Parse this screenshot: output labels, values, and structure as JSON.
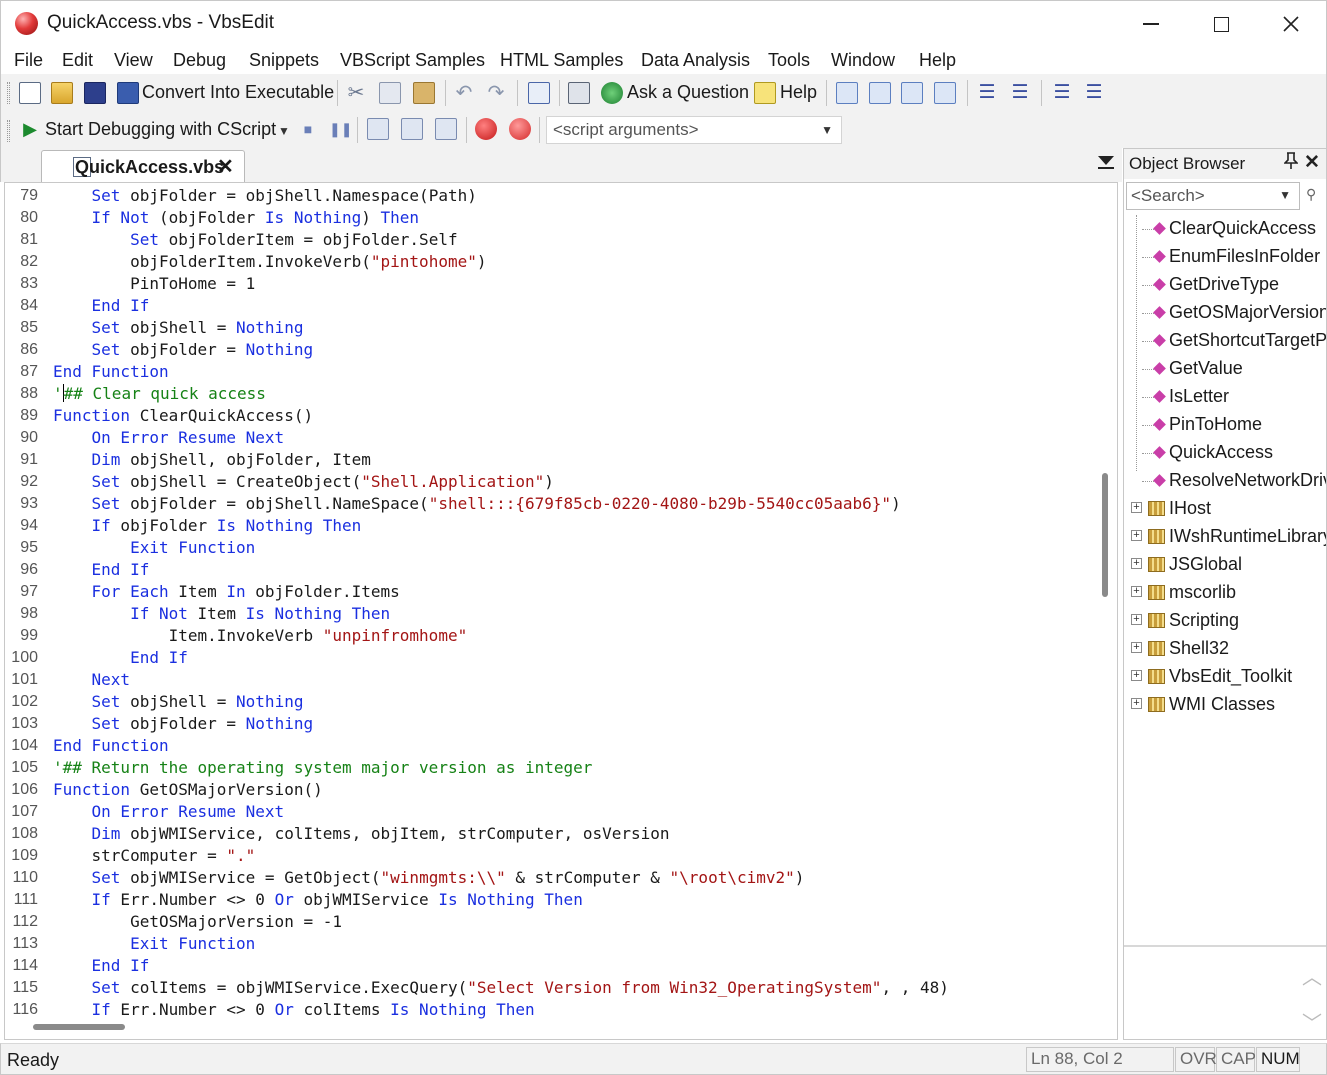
{
  "window": {
    "title": "QuickAccess.vbs - VbsEdit",
    "minimize_label": "—",
    "maximize_label": "☐",
    "close_label": "✕"
  },
  "menu": [
    "File",
    "Edit",
    "View",
    "Debug",
    "Snippets",
    "VBScript Samples",
    "HTML Samples",
    "Data Analysis",
    "Tools",
    "Window",
    "Help"
  ],
  "toolbar1": {
    "convert_label": "Convert Into Executable",
    "ask_label": "Ask a Question",
    "help_label": "Help",
    "icons": [
      "new-file-icon",
      "open-folder-icon",
      "save-icon",
      "convert-icon",
      "cut-icon",
      "copy-icon",
      "paste-icon",
      "undo-icon",
      "redo-icon",
      "browser-icon",
      "print-icon",
      "ask-icon",
      "help-icon",
      "bookmark-icons",
      "indent-icons"
    ]
  },
  "toolbar2": {
    "debug_label": "Start Debugging with CScript",
    "args_placeholder": "<script arguments>",
    "icons": [
      "play-icon",
      "stop-icon",
      "pause-icon",
      "step-icons",
      "breakpoint-icon",
      "clear-breakpoints-icon"
    ]
  },
  "editor": {
    "tab_label": "QuickAccess.vbs",
    "tab_close": "✕",
    "caret_line": 88,
    "lines": [
      {
        "n": "79",
        "segs": [
          [
            "",
            "    "
          ],
          [
            "kw",
            "Set"
          ],
          [
            "",
            " objFolder = objShell.Namespace(Path)"
          ]
        ]
      },
      {
        "n": "80",
        "segs": [
          [
            "",
            "    "
          ],
          [
            "kw",
            "If Not"
          ],
          [
            "",
            " (objFolder "
          ],
          [
            "kw",
            "Is Nothing"
          ],
          [
            "",
            ") "
          ],
          [
            "kw",
            "Then"
          ]
        ]
      },
      {
        "n": "81",
        "segs": [
          [
            "",
            "        "
          ],
          [
            "kw",
            "Set"
          ],
          [
            "",
            " objFolderItem = objFolder.Self"
          ]
        ]
      },
      {
        "n": "82",
        "segs": [
          [
            "",
            "        objFolderItem.InvokeVerb("
          ],
          [
            "str",
            "\"pintohome\""
          ],
          [
            "",
            ")"
          ]
        ]
      },
      {
        "n": "83",
        "segs": [
          [
            "",
            "        PinToHome = 1"
          ]
        ]
      },
      {
        "n": "84",
        "segs": [
          [
            "",
            "    "
          ],
          [
            "kw",
            "End If"
          ]
        ]
      },
      {
        "n": "85",
        "segs": [
          [
            "",
            "    "
          ],
          [
            "kw",
            "Set"
          ],
          [
            "",
            " objShell = "
          ],
          [
            "kw",
            "Nothing"
          ]
        ]
      },
      {
        "n": "86",
        "segs": [
          [
            "",
            "    "
          ],
          [
            "kw",
            "Set"
          ],
          [
            "",
            " objFolder = "
          ],
          [
            "kw",
            "Nothing"
          ]
        ]
      },
      {
        "n": "87",
        "segs": [
          [
            "kw",
            "End Function"
          ]
        ]
      },
      {
        "n": "88",
        "segs": [
          [
            "cmt",
            "'"
          ],
          [
            "caret",
            ""
          ],
          [
            "cmt",
            "## Clear quick access"
          ]
        ]
      },
      {
        "n": "89",
        "segs": [
          [
            "kw",
            "Function"
          ],
          [
            "",
            " ClearQuickAccess()"
          ]
        ]
      },
      {
        "n": "90",
        "segs": [
          [
            "",
            "    "
          ],
          [
            "kw",
            "On Error Resume Next"
          ]
        ]
      },
      {
        "n": "91",
        "segs": [
          [
            "",
            "    "
          ],
          [
            "kw",
            "Dim"
          ],
          [
            "",
            " objShell, objFolder, Item"
          ]
        ]
      },
      {
        "n": "92",
        "segs": [
          [
            "",
            "    "
          ],
          [
            "kw",
            "Set"
          ],
          [
            "",
            " objShell = CreateObject("
          ],
          [
            "str",
            "\"Shell.Application\""
          ],
          [
            "",
            ")"
          ]
        ]
      },
      {
        "n": "93",
        "segs": [
          [
            "",
            "    "
          ],
          [
            "kw",
            "Set"
          ],
          [
            "",
            " objFolder = objShell.NameSpace("
          ],
          [
            "str",
            "\"shell:::{679f85cb-0220-4080-b29b-5540cc05aab6}\""
          ],
          [
            "",
            ")"
          ]
        ]
      },
      {
        "n": "94",
        "segs": [
          [
            "",
            "    "
          ],
          [
            "kw",
            "If"
          ],
          [
            "",
            " objFolder "
          ],
          [
            "kw",
            "Is Nothing Then"
          ]
        ]
      },
      {
        "n": "95",
        "segs": [
          [
            "",
            "        "
          ],
          [
            "kw",
            "Exit Function"
          ]
        ]
      },
      {
        "n": "96",
        "segs": [
          [
            "",
            "    "
          ],
          [
            "kw",
            "End If"
          ]
        ]
      },
      {
        "n": "97",
        "segs": [
          [
            "",
            "    "
          ],
          [
            "kw",
            "For Each"
          ],
          [
            "",
            " Item "
          ],
          [
            "kw",
            "In"
          ],
          [
            "",
            " objFolder.Items"
          ]
        ]
      },
      {
        "n": "98",
        "segs": [
          [
            "",
            "        "
          ],
          [
            "kw",
            "If Not"
          ],
          [
            "",
            " Item "
          ],
          [
            "kw",
            "Is Nothing Then"
          ]
        ]
      },
      {
        "n": "99",
        "segs": [
          [
            "",
            "            Item.InvokeVerb "
          ],
          [
            "str",
            "\"unpinfromhome\""
          ]
        ]
      },
      {
        "n": "100",
        "segs": [
          [
            "",
            "        "
          ],
          [
            "kw",
            "End If"
          ]
        ]
      },
      {
        "n": "101",
        "segs": [
          [
            "",
            "    "
          ],
          [
            "kw",
            "Next"
          ]
        ]
      },
      {
        "n": "102",
        "segs": [
          [
            "",
            "    "
          ],
          [
            "kw",
            "Set"
          ],
          [
            "",
            " objShell = "
          ],
          [
            "kw",
            "Nothing"
          ]
        ]
      },
      {
        "n": "103",
        "segs": [
          [
            "",
            "    "
          ],
          [
            "kw",
            "Set"
          ],
          [
            "",
            " objFolder = "
          ],
          [
            "kw",
            "Nothing"
          ]
        ]
      },
      {
        "n": "104",
        "segs": [
          [
            "kw",
            "End Function"
          ]
        ]
      },
      {
        "n": "105",
        "segs": [
          [
            "cmt",
            "'## Return the operating system major version as integer"
          ]
        ]
      },
      {
        "n": "106",
        "segs": [
          [
            "kw",
            "Function"
          ],
          [
            "",
            " GetOSMajorVersion()"
          ]
        ]
      },
      {
        "n": "107",
        "segs": [
          [
            "",
            "    "
          ],
          [
            "kw",
            "On Error Resume Next"
          ]
        ]
      },
      {
        "n": "108",
        "segs": [
          [
            "",
            "    "
          ],
          [
            "kw",
            "Dim"
          ],
          [
            "",
            " objWMIService, colItems, objItem, strComputer, osVersion"
          ]
        ]
      },
      {
        "n": "109",
        "segs": [
          [
            "",
            "    strComputer = "
          ],
          [
            "str",
            "\".\""
          ]
        ]
      },
      {
        "n": "110",
        "segs": [
          [
            "",
            "    "
          ],
          [
            "kw",
            "Set"
          ],
          [
            "",
            " objWMIService = GetObject("
          ],
          [
            "str",
            "\"winmgmts:\\\\\""
          ],
          [
            "",
            " & strComputer & "
          ],
          [
            "str",
            "\"\\root\\cimv2\""
          ],
          [
            "",
            ")"
          ]
        ]
      },
      {
        "n": "111",
        "segs": [
          [
            "",
            "    "
          ],
          [
            "kw",
            "If"
          ],
          [
            "",
            " Err.Number <> 0 "
          ],
          [
            "kw",
            "Or"
          ],
          [
            "",
            " objWMIService "
          ],
          [
            "kw",
            "Is Nothing Then"
          ]
        ]
      },
      {
        "n": "112",
        "segs": [
          [
            "",
            "        GetOSMajorVersion = -1"
          ]
        ]
      },
      {
        "n": "113",
        "segs": [
          [
            "",
            "        "
          ],
          [
            "kw",
            "Exit Function"
          ]
        ]
      },
      {
        "n": "114",
        "segs": [
          [
            "",
            "    "
          ],
          [
            "kw",
            "End If"
          ]
        ]
      },
      {
        "n": "115",
        "segs": [
          [
            "",
            "    "
          ],
          [
            "kw",
            "Set"
          ],
          [
            "",
            " colItems = objWMIService.ExecQuery("
          ],
          [
            "str",
            "\"Select Version from Win32_OperatingSystem\""
          ],
          [
            "",
            ", , 48)"
          ]
        ]
      },
      {
        "n": "116",
        "segs": [
          [
            "",
            "    "
          ],
          [
            "kw",
            "If"
          ],
          [
            "",
            " Err.Number <> 0 "
          ],
          [
            "kw",
            "Or"
          ],
          [
            "",
            " colItems "
          ],
          [
            "kw",
            "Is Nothing Then"
          ]
        ]
      }
    ]
  },
  "object_browser": {
    "title": "Object Browser",
    "pin_label": "📌",
    "close_label": "✕",
    "search_placeholder": "<Search>",
    "methods": [
      "ClearQuickAccess",
      "EnumFilesInFolder",
      "GetDriveType",
      "GetOSMajorVersion",
      "GetShortcutTargetP",
      "GetValue",
      "IsLetter",
      "PinToHome",
      "QuickAccess",
      "ResolveNetworkDriv"
    ],
    "libraries": [
      "IHost",
      "IWshRuntimeLibrary",
      "JSGlobal",
      "mscorlib",
      "Scripting",
      "Shell32",
      "VbsEdit_Toolkit",
      "WMI Classes"
    ]
  },
  "status": {
    "text": "Ready",
    "position": "Ln 88, Col 2",
    "ovr": "OVR",
    "cap": "CAP",
    "num": "NUM"
  }
}
